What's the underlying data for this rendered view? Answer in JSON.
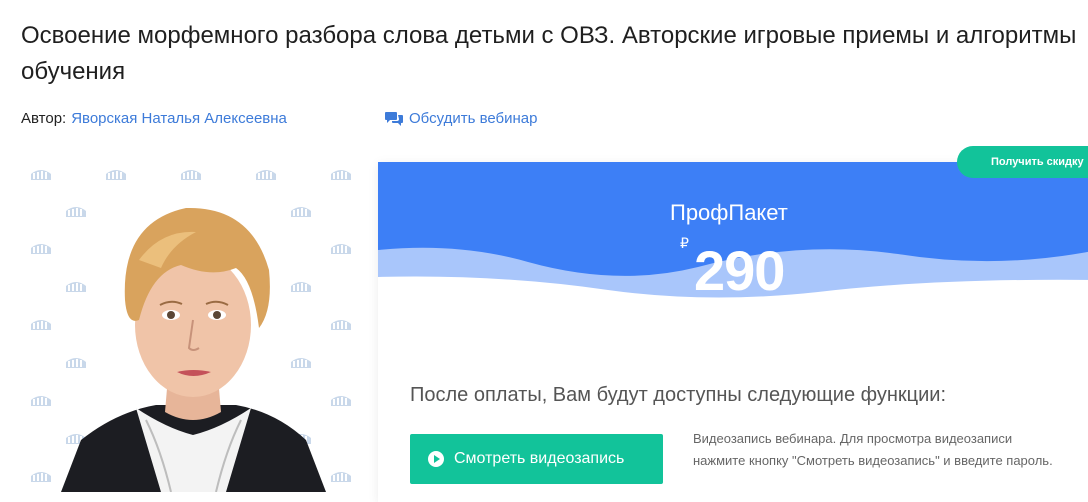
{
  "page": {
    "title": "Освоение морфемного разбора слова детьми с ОВЗ. Авторские игровые приемы и алгоритмы обучения"
  },
  "meta": {
    "author_label": "Автор:",
    "author_name": "Яворская Наталья Алексеевна",
    "discuss_label": "Обсудить вебинар",
    "discuss_icon": "chat-bubbles-icon"
  },
  "promo": {
    "discount_label": "Получить скидку"
  },
  "plan": {
    "name": "ПрофПакет",
    "currency": "₽",
    "price": "290",
    "features_heading": "После оплаты, Вам будут доступны следующие функции:",
    "watch_button_label": "Смотреть видеозапись",
    "watch_description": "Видеозапись вебинара. Для просмотра видеозаписи нажмите кнопку \"Смотреть видеозапись\" и введите пароль."
  },
  "colors": {
    "accent_blue": "#3d7ff6",
    "accent_green": "#12c39a",
    "link": "#3d7bd9"
  }
}
